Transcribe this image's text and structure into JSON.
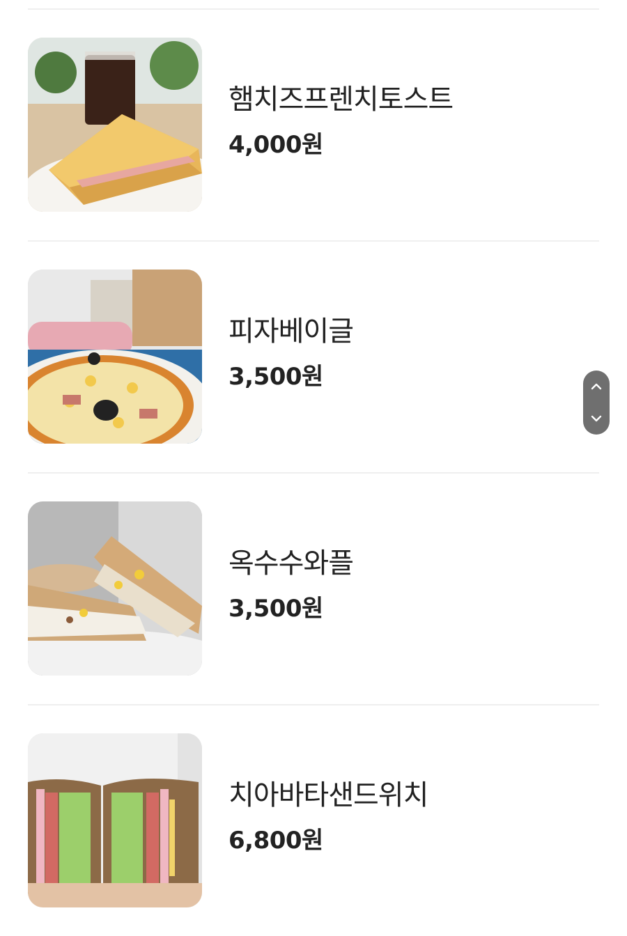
{
  "menu": {
    "items": [
      {
        "name": "햄치즈프렌치토스트",
        "price": "4,000원",
        "image_icon": "ham-cheese-french-toast-photo"
      },
      {
        "name": "피자베이글",
        "price": "3,500원",
        "image_icon": "pizza-bagel-photo"
      },
      {
        "name": "옥수수와플",
        "price": "3,500원",
        "image_icon": "corn-waffle-photo"
      },
      {
        "name": "치아바타샌드위치",
        "price": "6,800원",
        "image_icon": "ciabatta-sandwich-photo"
      }
    ]
  },
  "scroll_control": {
    "up_icon": "chevron-up-icon",
    "down_icon": "chevron-down-icon",
    "color": "#6f6f6f"
  }
}
